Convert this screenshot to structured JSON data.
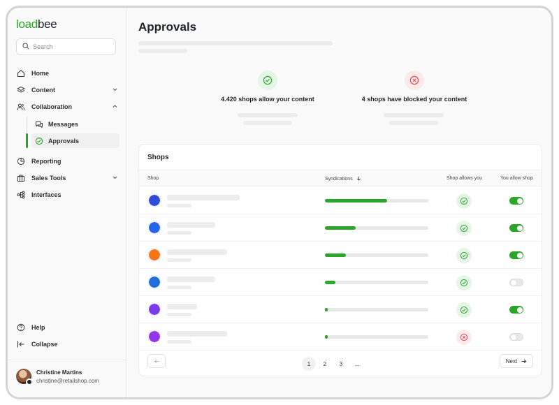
{
  "brand": {
    "part1": "load",
    "part2": "bee",
    "accent": "#2aa628"
  },
  "search": {
    "placeholder": "Search",
    "icon": "search-icon"
  },
  "nav": {
    "home": "Home",
    "content": "Content",
    "collaboration": "Collaboration",
    "messages": "Messages",
    "approvals": "Approvals",
    "reporting": "Reporting",
    "sales_tools": "Sales Tools",
    "interfaces": "Interfaces",
    "help": "Help",
    "collapse": "Collapse"
  },
  "user": {
    "name": "Christine Martins",
    "email": "christine@retailshop.com"
  },
  "page": {
    "title": "Approvals"
  },
  "stats": {
    "allow": "4.420 shops allow your content",
    "blocked": "4 shops have blocked your content"
  },
  "table": {
    "title": "Shops",
    "headers": {
      "shop": "Shop",
      "syndications": "Syndications",
      "shop_allows": "Shop allows you",
      "you_allow": "You allow shop"
    },
    "rows": [
      {
        "logo": "#2f4cdd",
        "progress": 0.6,
        "shop_allows": true,
        "you_allow": true
      },
      {
        "logo": "#2563eb",
        "progress": 0.3,
        "shop_allows": true,
        "you_allow": true
      },
      {
        "logo": "#f97316",
        "progress": 0.2,
        "shop_allows": true,
        "you_allow": true
      },
      {
        "logo": "#1e6fd9",
        "progress": 0.1,
        "shop_allows": true,
        "you_allow": false
      },
      {
        "logo": "#7c3aed",
        "progress": 0.02,
        "shop_allows": true,
        "you_allow": true
      },
      {
        "logo": "#9333ea",
        "progress": 0.02,
        "shop_allows": false,
        "you_allow": false
      }
    ]
  },
  "pagination": {
    "pages": [
      "1",
      "2",
      "3",
      "..."
    ],
    "current": "1",
    "next": "Next"
  }
}
